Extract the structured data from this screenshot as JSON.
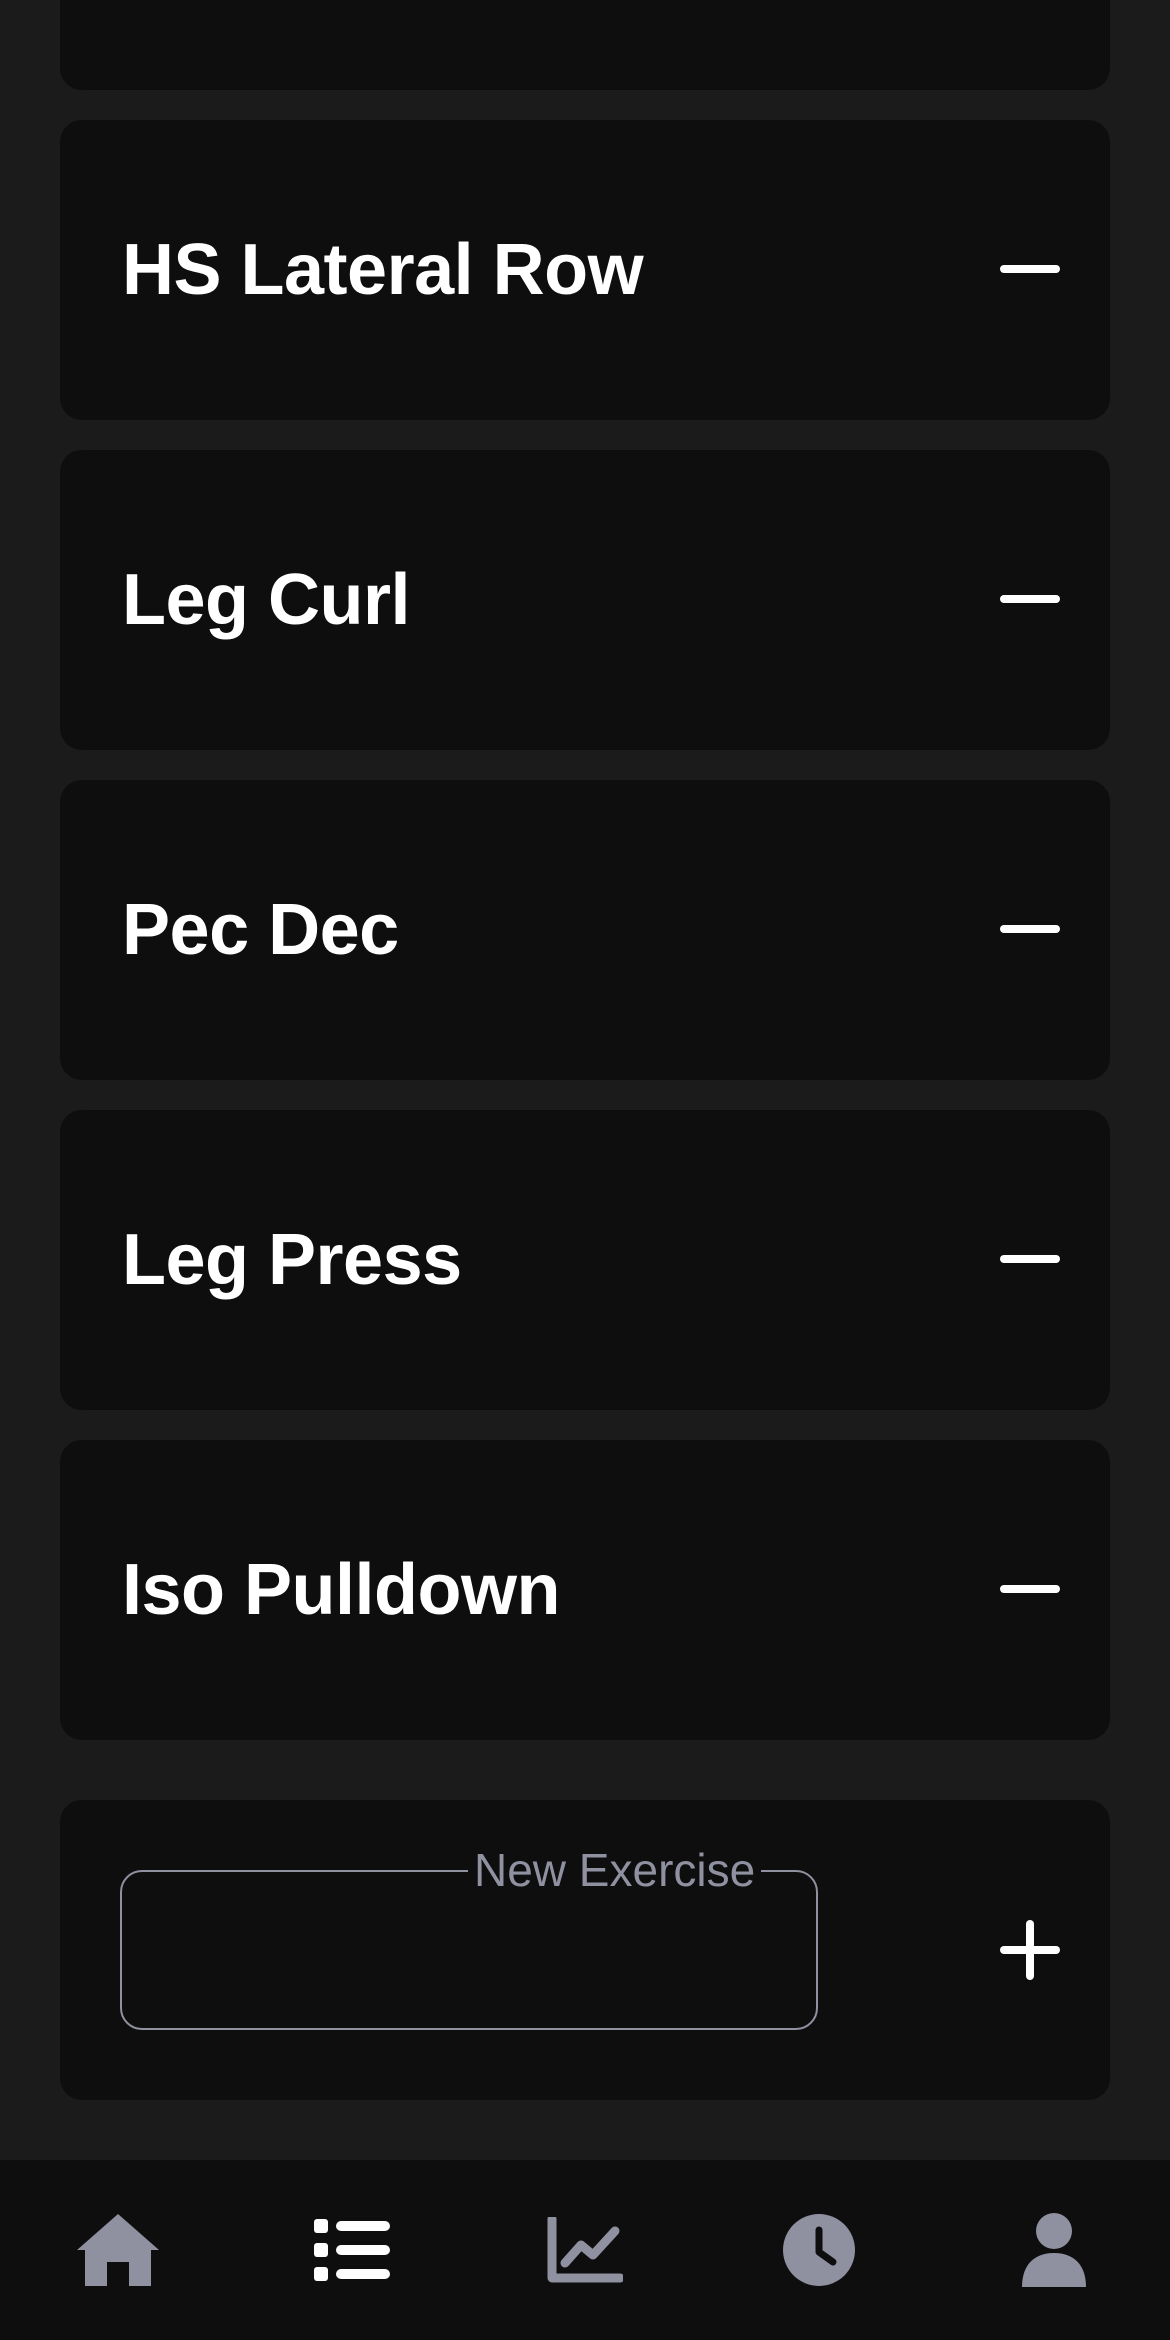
{
  "exercises": [
    {
      "name": "HS Lateral Row"
    },
    {
      "name": "Leg Curl"
    },
    {
      "name": "Pec Dec"
    },
    {
      "name": "Leg Press"
    },
    {
      "name": "Iso Pulldown"
    }
  ],
  "new_exercise": {
    "label": "New Exercise",
    "value": ""
  },
  "bottom_nav": {
    "items": [
      {
        "icon": "home-icon",
        "active": false
      },
      {
        "icon": "list-icon",
        "active": true
      },
      {
        "icon": "chart-icon",
        "active": false
      },
      {
        "icon": "clock-icon",
        "active": false
      },
      {
        "icon": "person-icon",
        "active": false
      }
    ]
  },
  "colors": {
    "background": "#1b1b1b",
    "card": "#0e0e0e",
    "text": "#ffffff",
    "muted": "#8f90a0",
    "nav_active": "#ffffff"
  }
}
